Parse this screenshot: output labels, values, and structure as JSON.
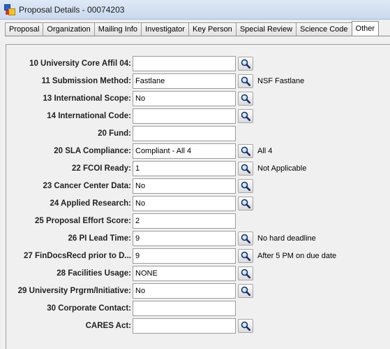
{
  "window": {
    "title": "Proposal Details - 00074203"
  },
  "tabs": [
    {
      "label": "Proposal"
    },
    {
      "label": "Organization"
    },
    {
      "label": "Mailing Info"
    },
    {
      "label": "Investigator"
    },
    {
      "label": "Key Person"
    },
    {
      "label": "Special Review"
    },
    {
      "label": "Science Code"
    },
    {
      "label": "Other",
      "active": true
    }
  ],
  "fields": [
    {
      "label": "10 University Core Affil 04:",
      "value": "",
      "lookup": true,
      "desc": ""
    },
    {
      "label": "11 Submission Method:",
      "value": "Fastlane",
      "lookup": true,
      "desc": "NSF Fastlane"
    },
    {
      "label": "13 International Scope:",
      "value": "No",
      "lookup": true,
      "desc": ""
    },
    {
      "label": "14 International Code:",
      "value": "",
      "lookup": true,
      "desc": ""
    },
    {
      "label": "20 Fund:",
      "value": "",
      "lookup": false,
      "desc": ""
    },
    {
      "label": "20 SLA Compliance:",
      "value": "Compliant - All 4",
      "lookup": true,
      "desc": "All 4"
    },
    {
      "label": "22 FCOI Ready:",
      "value": "1",
      "lookup": true,
      "desc": "Not Applicable"
    },
    {
      "label": "23 Cancer Center Data:",
      "value": "No",
      "lookup": true,
      "desc": ""
    },
    {
      "label": "24 Applied Research:",
      "value": "No",
      "lookup": true,
      "desc": ""
    },
    {
      "label": "25 Proposal Effort Score:",
      "value": "2",
      "lookup": false,
      "desc": ""
    },
    {
      "label": "26 PI Lead Time:",
      "value": "9",
      "lookup": true,
      "desc": "No hard deadline"
    },
    {
      "label": "27 FinDocsRecd prior to D...",
      "value": "9",
      "lookup": true,
      "desc": "After 5 PM on due date"
    },
    {
      "label": "28 Facilities Usage:",
      "value": "NONE",
      "lookup": true,
      "desc": ""
    },
    {
      "label": "29 University Prgrm/Initiative:",
      "value": "No",
      "lookup": true,
      "desc": ""
    },
    {
      "label": "30 Corporate Contact:",
      "value": "",
      "lookup": false,
      "desc": ""
    },
    {
      "label": "CARES Act:",
      "value": "",
      "lookup": true,
      "desc": ""
    }
  ],
  "icons": {
    "lookup": "magnifier-icon",
    "app": "app-icon"
  }
}
